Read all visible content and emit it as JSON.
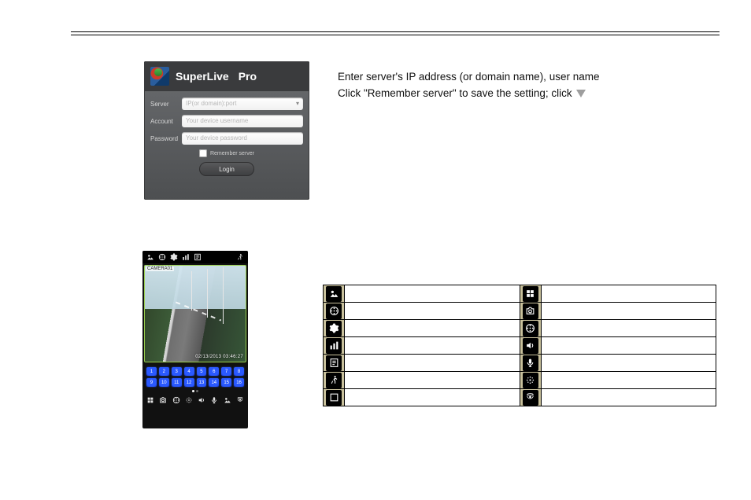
{
  "login": {
    "title_main": "SuperLive",
    "title_suffix": "Pro",
    "server_label": "Server",
    "account_label": "Account",
    "password_label": "Password",
    "server_placeholder": "IP(or domain):port",
    "account_placeholder": "Your device username",
    "password_placeholder": "Your device password",
    "remember_label": "Remember server",
    "login_button": "Login"
  },
  "instructions": {
    "line1": "Enter server's IP address (or domain name),   user name",
    "line2_pre": "Click \"Remember server\" to save the setting; click"
  },
  "live": {
    "camera_label": "CAMERA01",
    "timestamp": "02/13/2013  03:46:27",
    "channels": [
      "1",
      "2",
      "3",
      "4",
      "5",
      "6",
      "7",
      "8",
      "9",
      "10",
      "11",
      "12",
      "13",
      "14",
      "15",
      "16"
    ]
  },
  "legend": {
    "left": [
      {
        "icon": "image",
        "desc": ""
      },
      {
        "icon": "reel",
        "desc": ""
      },
      {
        "icon": "gear",
        "desc": ""
      },
      {
        "icon": "bars",
        "desc": ""
      },
      {
        "icon": "log",
        "desc": ""
      },
      {
        "icon": "run",
        "desc": ""
      },
      {
        "icon": "square",
        "desc": ""
      }
    ],
    "right": [
      {
        "icon": "grid",
        "desc": ""
      },
      {
        "icon": "camera",
        "desc": ""
      },
      {
        "icon": "reel",
        "desc": ""
      },
      {
        "icon": "sound",
        "desc": ""
      },
      {
        "icon": "mic",
        "desc": ""
      },
      {
        "icon": "ptz",
        "desc": ""
      },
      {
        "icon": "ball",
        "desc": ""
      }
    ]
  }
}
